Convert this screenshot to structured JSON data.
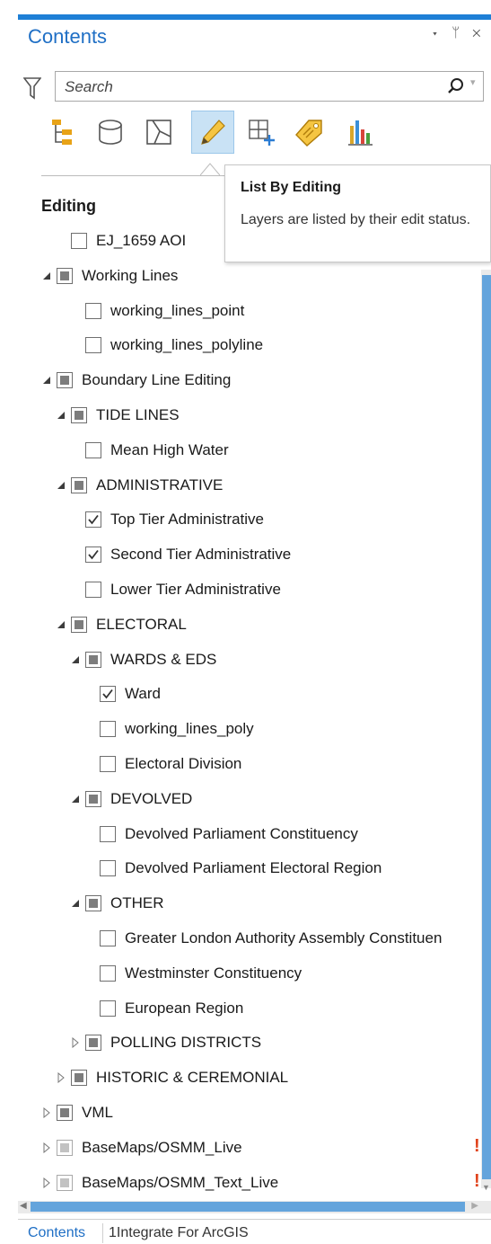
{
  "pane": {
    "title": "Contents",
    "controls": [
      "▾",
      "ᛘ",
      "✕"
    ]
  },
  "search": {
    "placeholder": "Search",
    "value": ""
  },
  "toolbar": {
    "icons": [
      "list-by-drawing-order-icon",
      "list-by-data-source-icon",
      "list-by-selection-icon",
      "list-by-editing-icon",
      "list-by-snapping-icon",
      "list-by-labeling-icon",
      "list-by-charts-icon"
    ],
    "active": "list-by-editing-icon",
    "colors": {
      "tree_orange": "#e8a317",
      "pencil_yellow": "#f5c542",
      "chart_bars": [
        "#d9a62a",
        "#3a8fd8",
        "#d8453b",
        "#4a9e3c"
      ]
    }
  },
  "tooltip": {
    "title": "List By Editing",
    "description": "Layers are listed by their edit status."
  },
  "section_label": "Editing",
  "tree": [
    {
      "label": "EJ_1659 AOI",
      "state": "unchecked",
      "expander": "none",
      "warning": false
    },
    {
      "label": "Working Lines",
      "state": "partial",
      "expander": "expanded",
      "warning": false
    },
    {
      "label": "working_lines_point",
      "state": "unchecked",
      "expander": "none",
      "warning": false
    },
    {
      "label": "working_lines_polyline",
      "state": "unchecked",
      "expander": "none",
      "warning": false
    },
    {
      "label": "Boundary Line Editing",
      "state": "partial",
      "expander": "expanded",
      "warning": false
    },
    {
      "label": "TIDE LINES",
      "state": "partial",
      "expander": "expanded",
      "warning": false
    },
    {
      "label": "Mean High Water",
      "state": "unchecked",
      "expander": "none",
      "warning": false
    },
    {
      "label": "ADMINISTRATIVE",
      "state": "partial",
      "expander": "expanded",
      "warning": false
    },
    {
      "label": "Top Tier Administrative",
      "state": "checked",
      "expander": "none",
      "warning": false
    },
    {
      "label": "Second Tier Administrative",
      "state": "checked",
      "expander": "none",
      "warning": false
    },
    {
      "label": "Lower Tier Administrative",
      "state": "unchecked",
      "expander": "none",
      "warning": false
    },
    {
      "label": "ELECTORAL",
      "state": "partial",
      "expander": "expanded",
      "warning": false
    },
    {
      "label": "WARDS & EDS",
      "state": "partial",
      "expander": "expanded",
      "warning": false
    },
    {
      "label": "Ward",
      "state": "checked",
      "expander": "none",
      "warning": false
    },
    {
      "label": "working_lines_poly",
      "state": "unchecked",
      "expander": "none",
      "warning": false
    },
    {
      "label": "Electoral Division",
      "state": "unchecked",
      "expander": "none",
      "warning": false
    },
    {
      "label": "DEVOLVED",
      "state": "partial",
      "expander": "expanded",
      "warning": false
    },
    {
      "label": "Devolved Parliament Constituency",
      "state": "unchecked",
      "expander": "none",
      "warning": false
    },
    {
      "label": "Devolved Parliament Electoral Region",
      "state": "unchecked",
      "expander": "none",
      "warning": false
    },
    {
      "label": "OTHER",
      "state": "partial",
      "expander": "expanded",
      "warning": false
    },
    {
      "label": "Greater London Authority Assembly Constituen",
      "state": "unchecked",
      "expander": "none",
      "warning": false
    },
    {
      "label": "Westminster Constituency",
      "state": "unchecked",
      "expander": "none",
      "warning": false
    },
    {
      "label": "European Region",
      "state": "unchecked",
      "expander": "none",
      "warning": false
    },
    {
      "label": "POLLING DISTRICTS",
      "state": "partial",
      "expander": "collapsed",
      "warning": false
    },
    {
      "label": "HISTORIC & CEREMONIAL",
      "state": "partial",
      "expander": "collapsed",
      "warning": false
    },
    {
      "label": "VML",
      "state": "partial",
      "expander": "collapsed",
      "warning": false
    },
    {
      "label": "BaseMaps/OSMM_Live",
      "state": "partial-light",
      "expander": "collapsed",
      "warning": true
    },
    {
      "label": "BaseMaps/OSMM_Text_Live",
      "state": "partial-light",
      "expander": "collapsed",
      "warning": true
    }
  ],
  "warning_symbol": "!",
  "bottom_tabs": [
    {
      "label": "Contents",
      "active": true
    },
    {
      "label": "1Integrate For ArcGIS",
      "active": false
    }
  ]
}
